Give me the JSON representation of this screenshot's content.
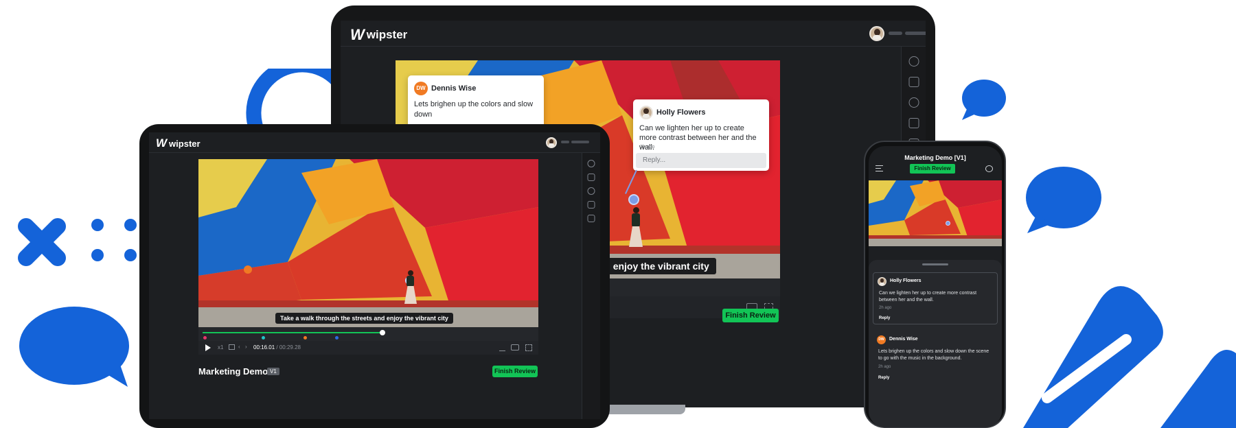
{
  "brand": {
    "name": "wipster",
    "mark": "W"
  },
  "colors": {
    "accent_blue": "#1463d9",
    "finish_green": "#12c456",
    "comment_orange": "#f07a23",
    "timeline_green": "#12c456"
  },
  "icons": [
    "info-icon",
    "comment-icon",
    "clock-icon",
    "document-icon",
    "captions-icon",
    "download-icon",
    "cc-icon",
    "fullscreen-icon",
    "play-icon",
    "menu-icon",
    "chat-icon",
    "chevron-left-icon",
    "chevron-right-icon"
  ],
  "laptop": {
    "caption": "eets and enjoy the vibrant city",
    "finish_button": "Finish Review",
    "comment_dennis": {
      "initials": "DW",
      "name": "Dennis Wise",
      "text": "Lets brighen up the colors and slow down"
    },
    "comment_holly": {
      "name": "Holly Flowers",
      "text": "Can we lighten her up to create more contrast between her and the wall.",
      "time": "2h ago",
      "reply_placeholder": "Reply..."
    }
  },
  "tablet": {
    "caption": "Take a walk through the streets and enjoy the vibrant city",
    "playback_speed": "x1",
    "current_time": "00:16.01",
    "time_separator": "/",
    "duration": "00:29.28",
    "progress": 0.53,
    "title": "Marketing Demo",
    "version": "V1",
    "finish_button": "Finish Review"
  },
  "phone": {
    "title": "Marketing Demo [V1]",
    "finish_button": "Finish Review",
    "comments": [
      {
        "name": "Holly Flowers",
        "text": "Can we lighten her up to create more contrast between her and the wall.",
        "time": "2h ago",
        "reply": "Reply"
      },
      {
        "initials": "DW",
        "name": "Dennis Wise",
        "text": "Lets brighen up the colors and slow down the scene to go with the music in the background.",
        "time": "2h ago",
        "reply": "Reply"
      }
    ]
  }
}
